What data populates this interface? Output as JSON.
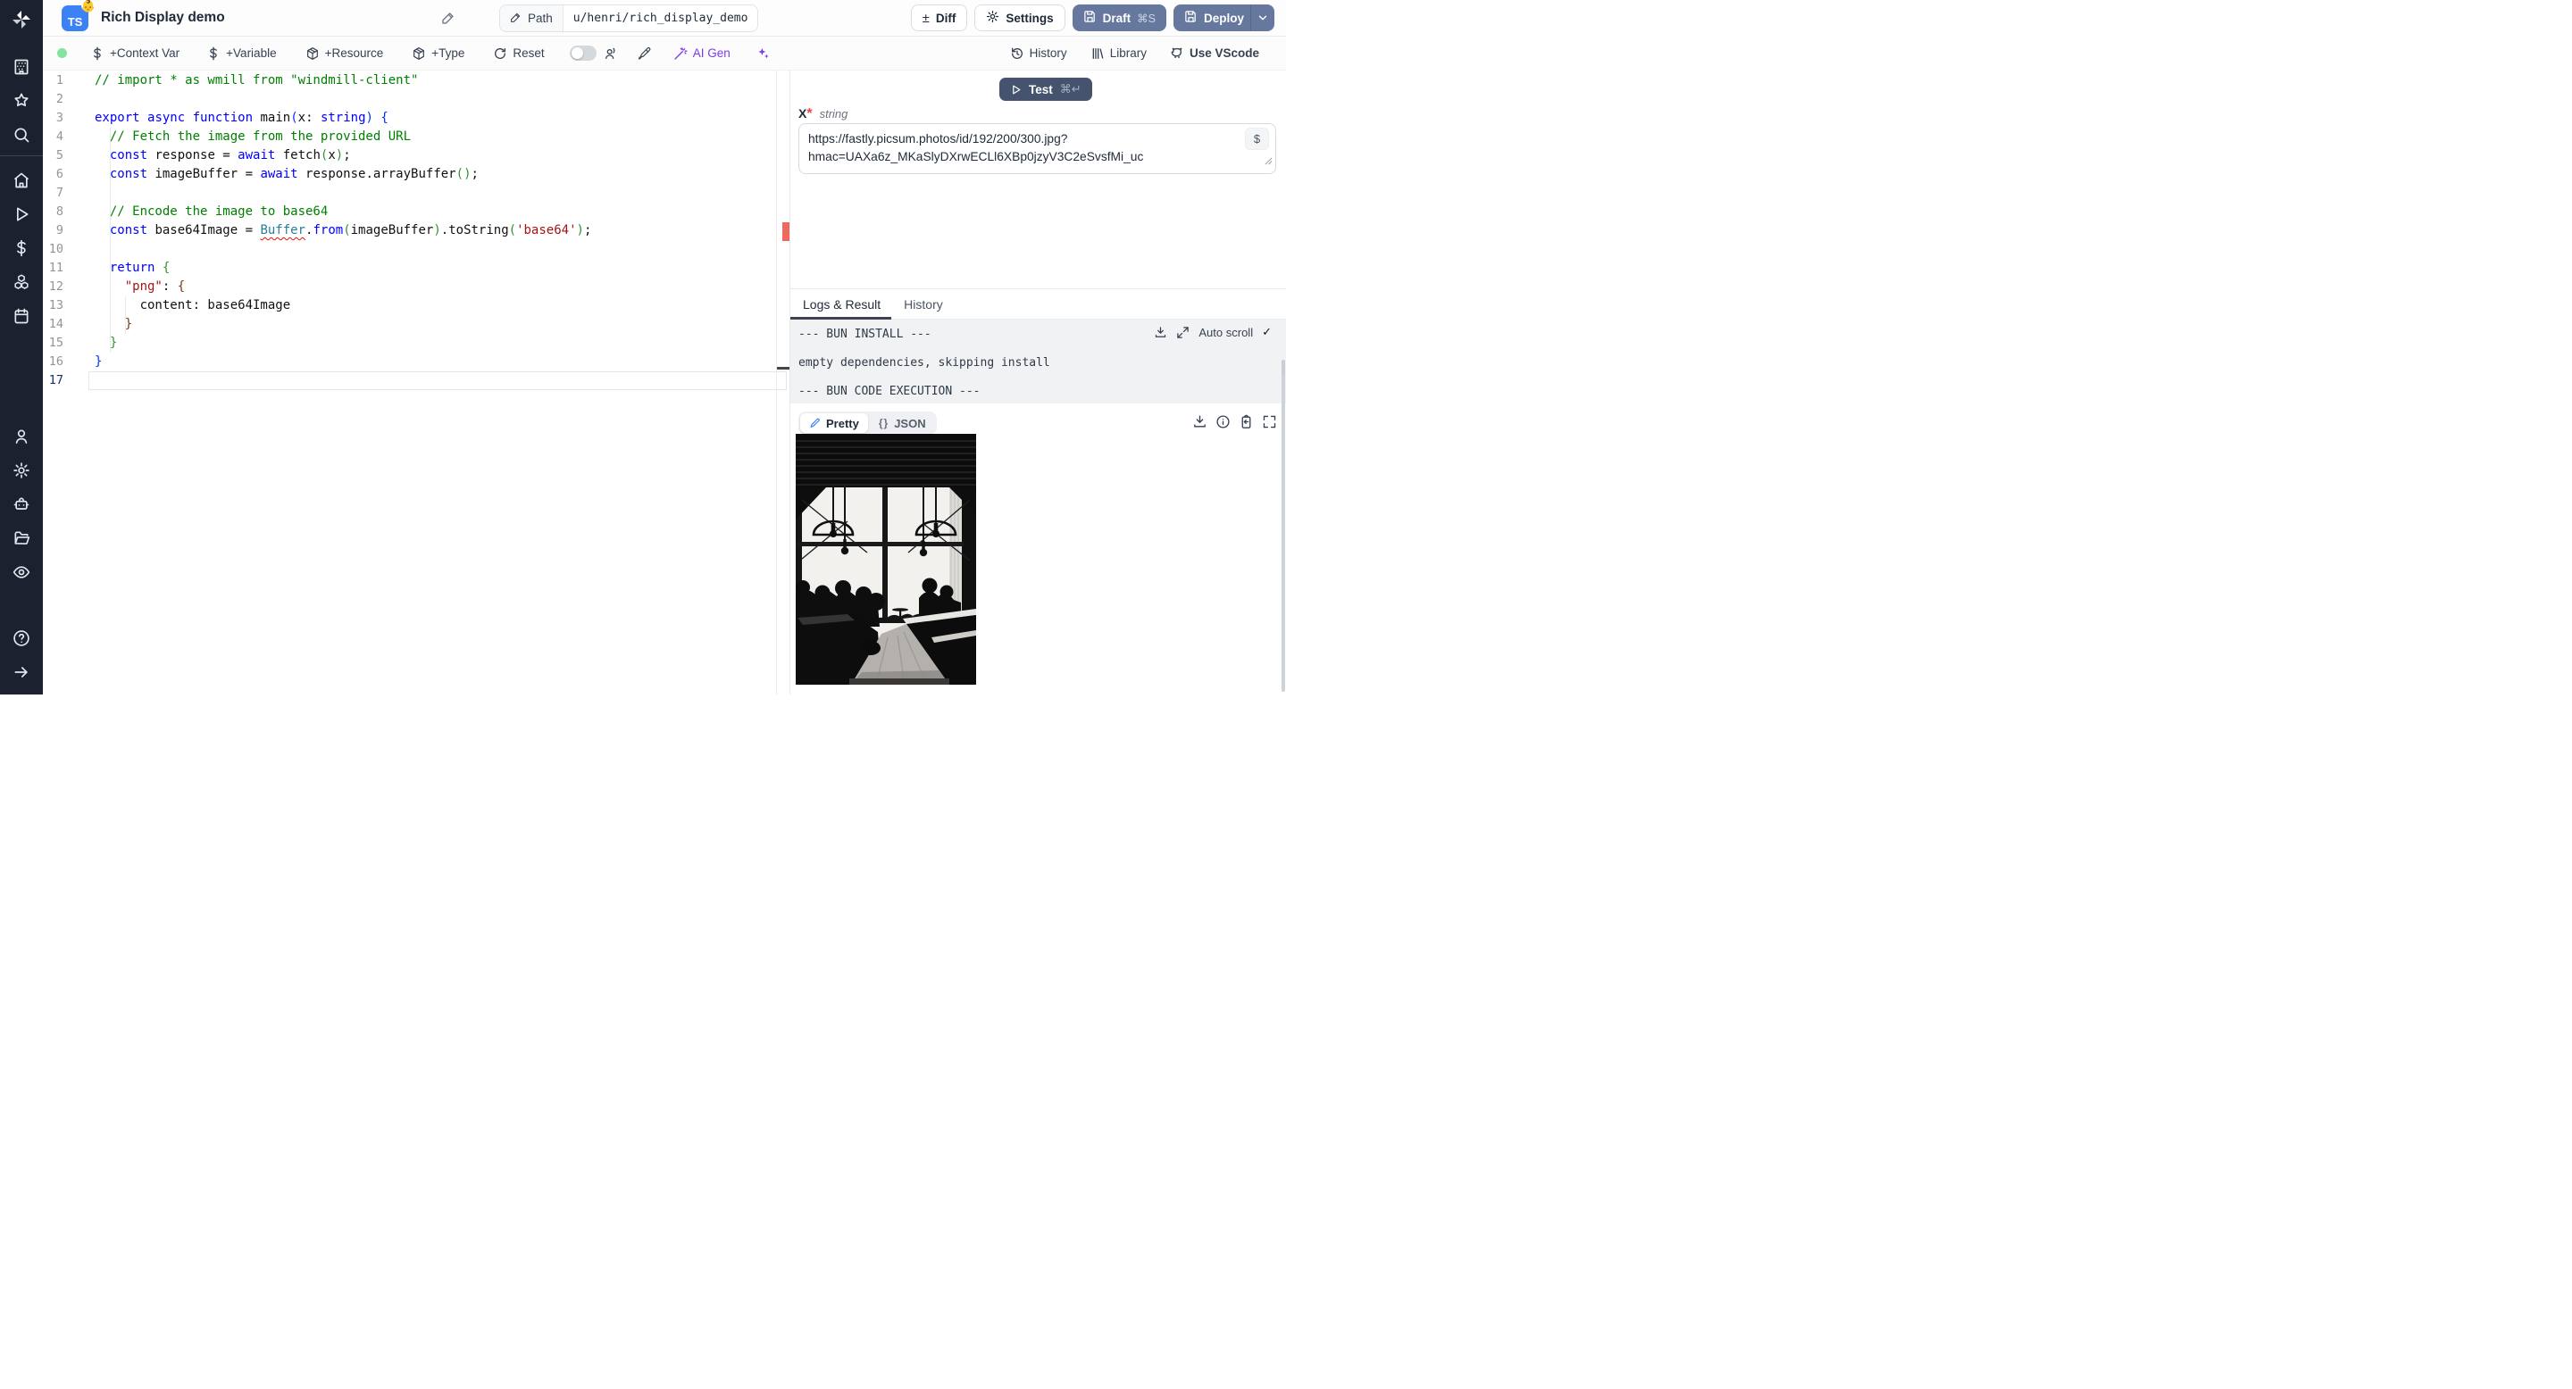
{
  "colors": {
    "accent_blue": "#3b82f6",
    "deploy_slate": "#66789e",
    "ai_purple": "#7c3aed",
    "live_green": "#86e29f",
    "error_red": "#ec6a5e",
    "tab_underline": "#3c4454"
  },
  "header": {
    "title": "Rich Display demo",
    "lang_badge": "TS",
    "badge_emoji": "👶",
    "path_label": "Path",
    "path_value": "u/henri/rich_display_demo",
    "diff_label": "Diff",
    "settings_label": "Settings",
    "draft_label": "Draft",
    "draft_shortcut": "⌘S",
    "deploy_label": "Deploy"
  },
  "icons": {
    "plus_minus": "±",
    "braces": "{}",
    "check": "✓"
  },
  "toolbar": {
    "context_var": "+Context Var",
    "variable": "+Variable",
    "resource": "+Resource",
    "type": "+Type",
    "reset": "Reset",
    "ai_gen": "AI Gen",
    "history": "History",
    "library": "Library",
    "use_vscode": "Use VScode"
  },
  "sidebar": {
    "top_icons": [
      "windmill-logo",
      "building-icon",
      "star-icon",
      "search-icon"
    ],
    "mid_icons": [
      "home-icon",
      "play-icon",
      "dollar-icon",
      "cubes-icon",
      "calendar-icon"
    ],
    "bottom_icons": [
      "user-icon",
      "gear-icon",
      "robot-icon",
      "folder-icon",
      "eye-icon",
      "help-icon",
      "arrow-right-icon"
    ]
  },
  "editor": {
    "lines": [
      {
        "n": 1,
        "s": [
          [
            "cm",
            "// import * as wmill from \"windmill-client\""
          ]
        ]
      },
      {
        "n": 2,
        "s": []
      },
      {
        "n": 3,
        "s": [
          [
            "kw",
            "export"
          ],
          [
            "tx",
            " "
          ],
          [
            "kw",
            "async"
          ],
          [
            "tx",
            " "
          ],
          [
            "kw",
            "function"
          ],
          [
            "tx",
            " main"
          ],
          [
            "b1",
            "("
          ],
          [
            "tx",
            "x: "
          ],
          [
            "kw",
            "string"
          ],
          [
            "b1",
            ")"
          ],
          [
            "tx",
            " "
          ],
          [
            "b1",
            "{"
          ]
        ]
      },
      {
        "n": 4,
        "g": [
          2
        ],
        "s": [
          [
            "tx",
            "  "
          ],
          [
            "cm",
            "// Fetch the image from the provided URL"
          ]
        ]
      },
      {
        "n": 5,
        "g": [
          2
        ],
        "s": [
          [
            "tx",
            "  "
          ],
          [
            "kw",
            "const"
          ],
          [
            "tx",
            " response = "
          ],
          [
            "kw",
            "await"
          ],
          [
            "tx",
            " fetch"
          ],
          [
            "b2",
            "("
          ],
          [
            "tx",
            "x"
          ],
          [
            "b2",
            ")"
          ],
          [
            "tx",
            ";"
          ]
        ]
      },
      {
        "n": 6,
        "g": [
          2
        ],
        "s": [
          [
            "tx",
            "  "
          ],
          [
            "kw",
            "const"
          ],
          [
            "tx",
            " imageBuffer = "
          ],
          [
            "kw",
            "await"
          ],
          [
            "tx",
            " response.arrayBuffer"
          ],
          [
            "b2",
            "("
          ],
          [
            "b2",
            ")"
          ],
          [
            "tx",
            ";"
          ]
        ]
      },
      {
        "n": 7,
        "g": [
          2
        ],
        "s": []
      },
      {
        "n": 8,
        "g": [
          2
        ],
        "s": [
          [
            "tx",
            "  "
          ],
          [
            "cm",
            "// Encode the image to base64"
          ]
        ]
      },
      {
        "n": 9,
        "g": [
          2
        ],
        "s": [
          [
            "tx",
            "  "
          ],
          [
            "kw",
            "const"
          ],
          [
            "tx",
            " base64Image = "
          ],
          [
            "tyerr",
            "Buffer"
          ],
          [
            "tx",
            "."
          ],
          [
            "kw",
            "from"
          ],
          [
            "b2",
            "("
          ],
          [
            "tx",
            "imageBuffer"
          ],
          [
            "b2",
            ")"
          ],
          [
            "tx",
            ".toString"
          ],
          [
            "b2",
            "("
          ],
          [
            "s",
            "'base64'"
          ],
          [
            "b2",
            ")"
          ],
          [
            "tx",
            ";"
          ]
        ]
      },
      {
        "n": 10,
        "g": [
          2
        ],
        "s": []
      },
      {
        "n": 11,
        "g": [
          2
        ],
        "s": [
          [
            "tx",
            "  "
          ],
          [
            "kw",
            "return"
          ],
          [
            "tx",
            " "
          ],
          [
            "b2",
            "{"
          ]
        ]
      },
      {
        "n": 12,
        "g": [
          2
        ],
        "s": [
          [
            "tx",
            "    "
          ],
          [
            "s",
            "\"png\""
          ],
          [
            "tx",
            ": "
          ],
          [
            "b3",
            "{"
          ]
        ]
      },
      {
        "n": 13,
        "g": [
          2,
          4
        ],
        "s": [
          [
            "tx",
            "      content: base64Image"
          ]
        ]
      },
      {
        "n": 14,
        "g": [
          2,
          4
        ],
        "s": [
          [
            "tx",
            "    "
          ],
          [
            "b3",
            "}"
          ]
        ]
      },
      {
        "n": 15,
        "g": [
          2
        ],
        "s": [
          [
            "tx",
            "  "
          ],
          [
            "b2",
            "}"
          ]
        ]
      },
      {
        "n": 16,
        "s": [
          [
            "b1",
            "}"
          ]
        ]
      },
      {
        "n": 17,
        "cur": true,
        "s": []
      }
    ]
  },
  "run": {
    "test_label": "Test",
    "test_shortcut": "⌘↵",
    "arg_name": "x",
    "arg_required_mark": "*",
    "arg_type": "string",
    "arg_value_line1": "https://fastly.picsum.photos/id/192/200/300.jpg?",
    "arg_value_line2": "hmac=UAXa6z_MKaSlyDXrwECLl6XBp0jzyV3C2eSvsfMi_uc",
    "dollar": "$"
  },
  "results": {
    "tab_logs": "Logs & Result",
    "tab_history": "History",
    "log_lines": [
      "--- BUN INSTALL ---",
      "empty dependencies, skipping install",
      "--- BUN CODE EXECUTION ---"
    ],
    "auto_scroll": "Auto scroll",
    "pretty_label": "Pretty",
    "json_label": "JSON",
    "result_image_alt": "black and white photo: silhouettes of people at cafe tables in front of large bright windows with dome pendant lamps"
  }
}
